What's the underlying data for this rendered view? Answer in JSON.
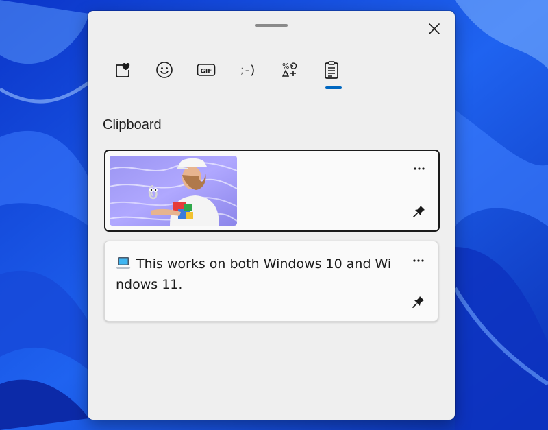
{
  "panel": {
    "close_label": "Close",
    "tabs": [
      {
        "name": "favorites",
        "icon": "heart-box-icon"
      },
      {
        "name": "emoji",
        "icon": "smiley-icon"
      },
      {
        "name": "gif",
        "label": "GIF",
        "icon": "gif-icon"
      },
      {
        "name": "kaomoji",
        "label": ";-)",
        "icon": "kaomoji-icon"
      },
      {
        "name": "symbols",
        "icon": "symbols-icon"
      },
      {
        "name": "clipboard",
        "icon": "clipboard-icon",
        "selected": true
      }
    ],
    "section_title": "Clipboard",
    "items": [
      {
        "type": "image",
        "selected": true
      },
      {
        "type": "text",
        "text": "This works on both Windows 10 and Windows 11.",
        "emoji": "laptop-icon"
      }
    ]
  },
  "colors": {
    "accent": "#0067c0",
    "panel_bg": "#efefef",
    "wallpaper": "#1a4fd8"
  }
}
